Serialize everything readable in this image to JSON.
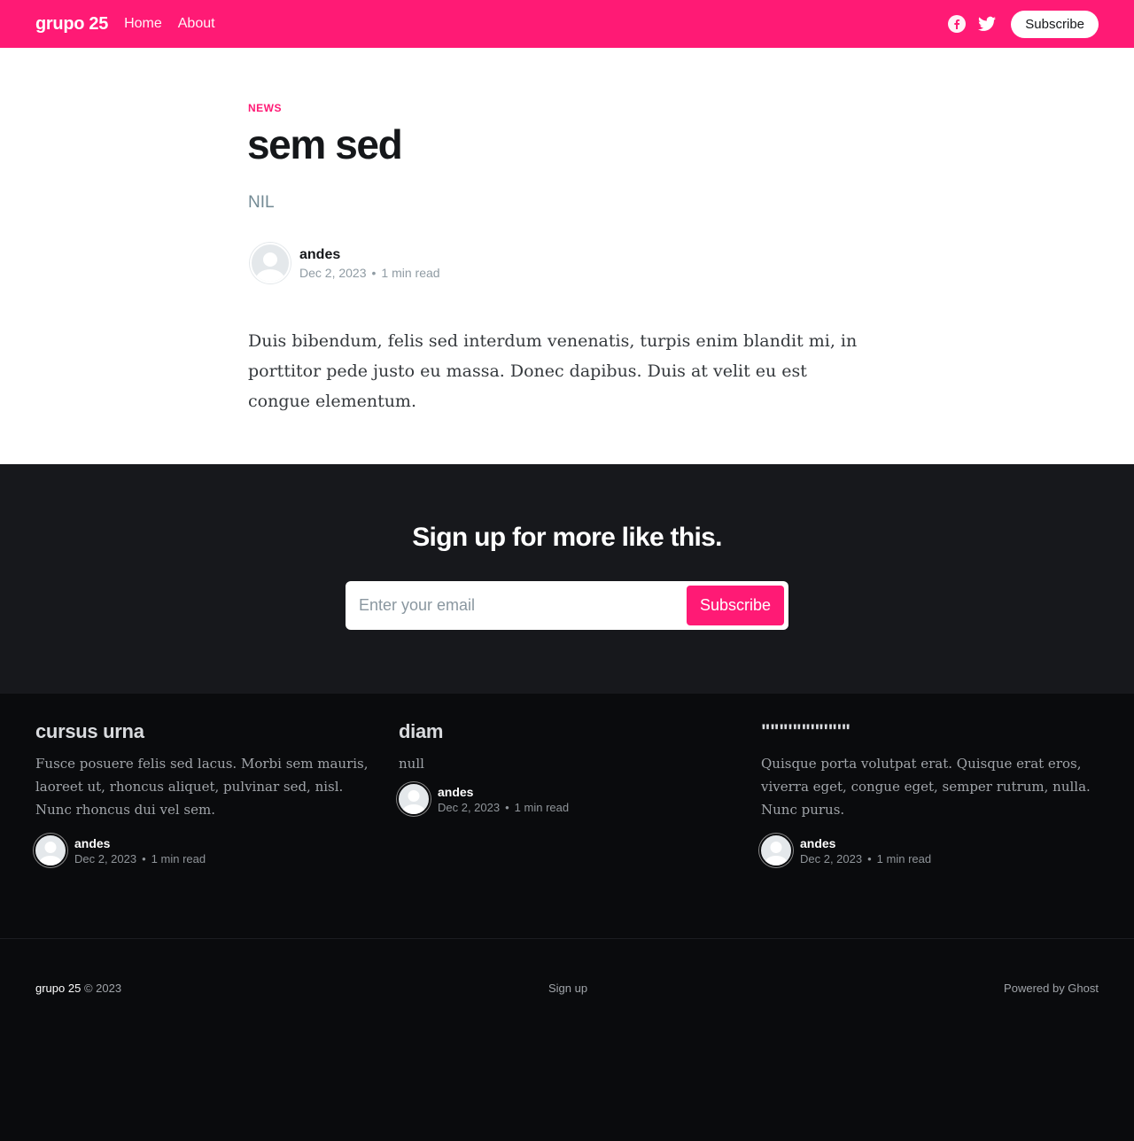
{
  "header": {
    "brand": "grupo 25",
    "nav": [
      {
        "label": "Home"
      },
      {
        "label": "About"
      }
    ],
    "subscribe_label": "Subscribe",
    "social_icons": [
      "facebook-icon",
      "twitter-icon"
    ]
  },
  "article": {
    "tag": "NEWS",
    "title": "sem sed",
    "excerpt": "NIL",
    "author": "andes",
    "date": "Dec 2, 2023",
    "dot": "•",
    "read_time": "1 min read",
    "body": "Duis bibendum, felis sed interdum venenatis, turpis enim blandit mi, in porttitor pede justo eu massa. Donec dapibus. Duis at velit eu est congue elementum."
  },
  "cta": {
    "title": "Sign up for more like this.",
    "email_placeholder": "Enter your email",
    "button_label": "Subscribe"
  },
  "related": [
    {
      "title": "cursus urna",
      "excerpt": "Fusce posuere felis sed lacus. Morbi sem mauris, laoreet ut, rhoncus aliquet, pulvinar sed, nisl. Nunc rhoncus dui vel sem.",
      "author": "andes",
      "date": "Dec 2, 2023",
      "read_time": "1 min read"
    },
    {
      "title": "diam",
      "excerpt": "null",
      "author": "andes",
      "date": "Dec 2, 2023",
      "read_time": "1 min read"
    },
    {
      "title": "\"\"\"'\"\"'\"'\"'\"",
      "excerpt": "Quisque porta volutpat erat. Quisque erat eros, viverra eget, congue eget, semper rutrum, nulla. Nunc purus.",
      "author": "andes",
      "date": "Dec 2, 2023",
      "read_time": "1 min read"
    }
  ],
  "footer": {
    "brand": "grupo 25",
    "copyright": "© 2023",
    "signup": "Sign up",
    "powered_by": "Powered by Ghost"
  },
  "colors": {
    "accent": "#ff1a75",
    "cta_bg": "#17181c",
    "footer_bg": "#0a0b0d"
  }
}
